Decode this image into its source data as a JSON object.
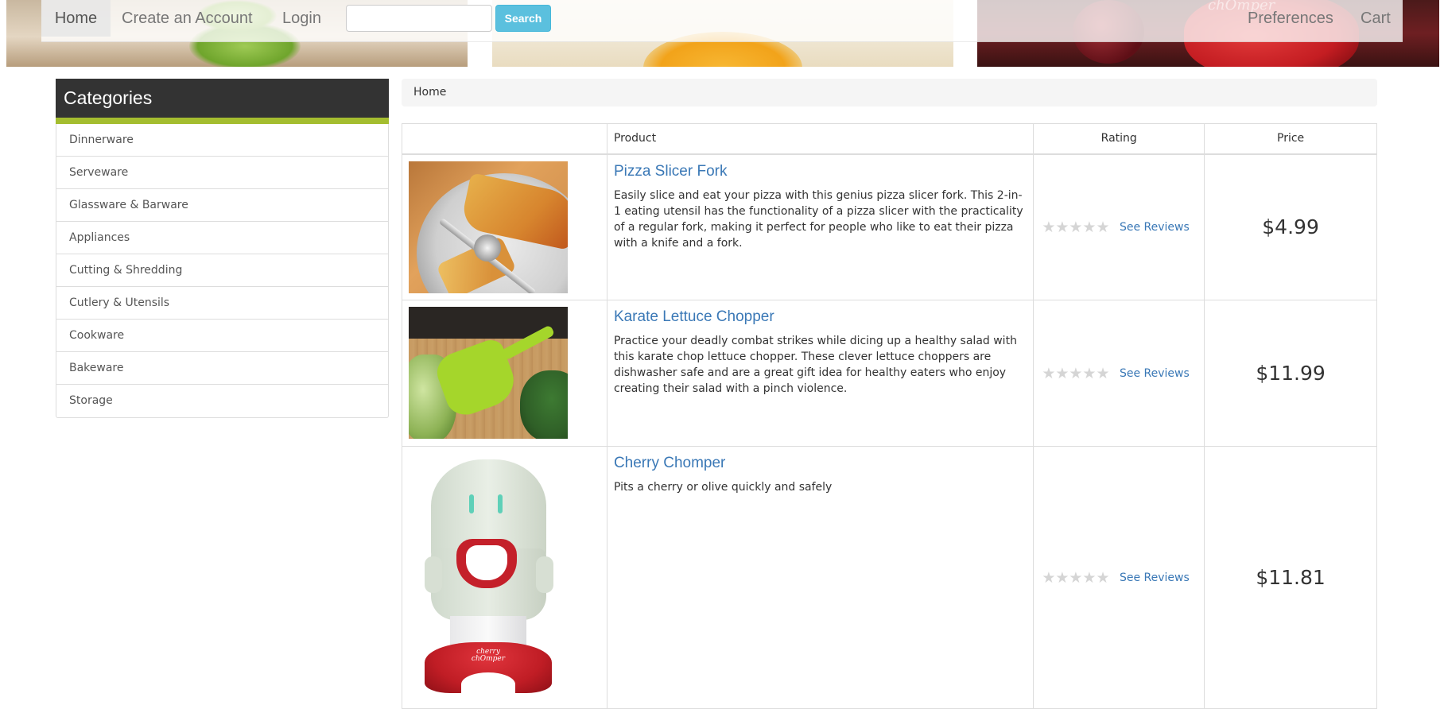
{
  "navbar": {
    "home": "Home",
    "create_account": "Create an Account",
    "login": "Login",
    "search_value": "",
    "search_button": "Search",
    "preferences": "Preferences",
    "cart": "Cart"
  },
  "sidebar": {
    "title": "Categories",
    "items": [
      {
        "label": "Dinnerware"
      },
      {
        "label": "Serveware"
      },
      {
        "label": "Glassware & Barware"
      },
      {
        "label": "Appliances"
      },
      {
        "label": "Cutting & Shredding"
      },
      {
        "label": "Cutlery & Utensils"
      },
      {
        "label": "Cookware"
      },
      {
        "label": "Bakeware"
      },
      {
        "label": "Storage"
      }
    ]
  },
  "breadcrumb": {
    "current": "Home"
  },
  "table": {
    "headers": {
      "image": "",
      "product": "Product",
      "rating": "Rating",
      "price": "Price"
    },
    "rows": [
      {
        "name": "Pizza Slicer Fork",
        "description": "Easily slice and eat your pizza with this genius pizza slicer fork. This 2-in-1 eating utensil has the functionality of a pizza slicer with the practicality of a regular fork, making it perfect for people who like to eat their pizza with a knife and a fork.",
        "rating_stars": 0,
        "reviews_link": "See Reviews",
        "price": "$4.99",
        "image_icon": "pizza-slicer-fork-photo"
      },
      {
        "name": "Karate Lettuce Chopper",
        "description": "Practice your deadly combat strikes while dicing up a healthy salad with this karate chop lettuce chopper. These clever lettuce choppers are dishwasher safe and are a great gift idea for healthy eaters who enjoy creating their salad with a pinch violence.",
        "rating_stars": 0,
        "reviews_link": "See Reviews",
        "price": "$11.99",
        "image_icon": "lettuce-chopper-photo"
      },
      {
        "name": "Cherry Chomper",
        "description": "Pits a cherry or olive quickly and safely",
        "rating_stars": 0,
        "reviews_link": "See Reviews",
        "price": "$11.81",
        "image_icon": "cherry-chomper-photo",
        "image_label_line1": "cherry",
        "image_label_line2": "chOmper"
      }
    ]
  },
  "banner": {
    "watermark_text": "chOmper"
  },
  "colors": {
    "accent_link": "#3a78b6",
    "sidebar_header_bg": "#333333",
    "sidebar_underline": "#a4bd2f",
    "search_button": "#5bc0de",
    "star_empty": "#d5d5d5"
  }
}
